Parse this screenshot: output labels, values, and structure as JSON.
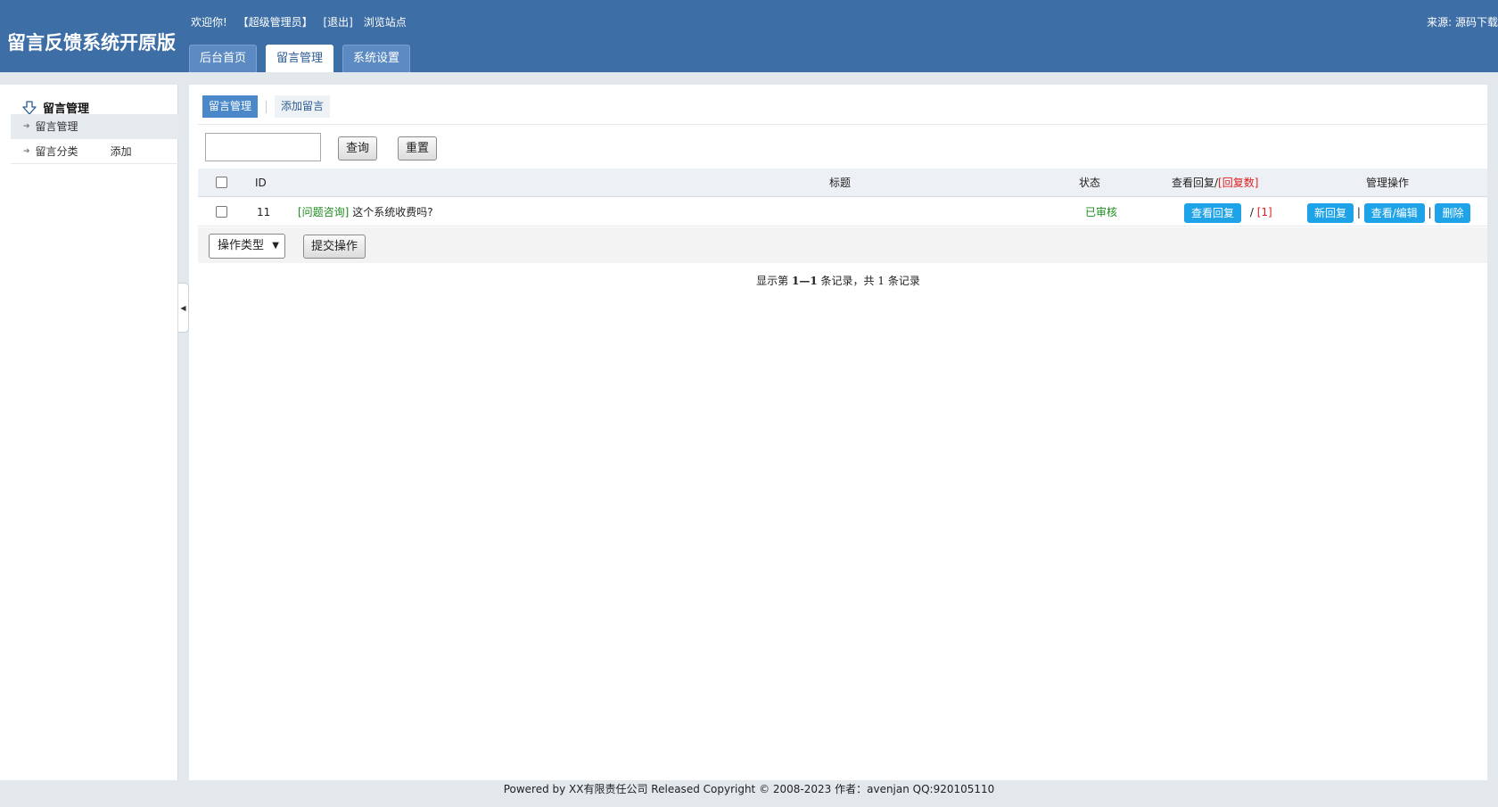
{
  "header": {
    "logo": "留言反馈系统开原版",
    "welcome": "欢迎你!",
    "role": "【超级管理员】",
    "logout": "[退出]",
    "browse": "浏览站点",
    "source": "来源: 源码下载",
    "tabs": [
      {
        "label": "后台首页"
      },
      {
        "label": "留言管理"
      },
      {
        "label": "系统设置"
      }
    ]
  },
  "sidebar": {
    "title": "留言管理",
    "items": [
      {
        "label": "留言管理",
        "extra": ""
      },
      {
        "label": "留言分类",
        "extra": "添加"
      }
    ]
  },
  "main": {
    "subtabs": [
      {
        "label": "留言管理"
      },
      {
        "label": "添加留言"
      }
    ],
    "search": {
      "value": "",
      "query_button": "查询",
      "reset_button": "重置"
    },
    "table": {
      "columns": [
        "ID",
        "标题",
        "状态",
        "查看回复/",
        "[回复数]",
        "管理操作"
      ],
      "rows": [
        {
          "id": "11",
          "category": "[问题咨询]",
          "title": "这个系统收费吗?",
          "status": "已审核",
          "view_reply": "查看回复",
          "slash": "/",
          "reply_count": "[1]",
          "new_reply": "新回复",
          "view_edit": "查看/编辑",
          "delete": "删除",
          "sep": "|"
        }
      ]
    },
    "actions": {
      "select_value": "操作类型",
      "submit": "提交操作"
    },
    "pager": {
      "prefix": "显示第",
      "range": "1—1",
      "mid": "条记录，共",
      "total": "1",
      "suffix": "条记录"
    }
  },
  "footer": {
    "text": "Powered by XX有限责任公司  Released Copyright © 2008-2023 作者：avenjan QQ:920105110"
  },
  "colors": {
    "header_bg": "#3d6ea5",
    "accent_blue": "#1fa3e8",
    "status_green": "#1e8a1e",
    "count_red": "#e02020"
  }
}
